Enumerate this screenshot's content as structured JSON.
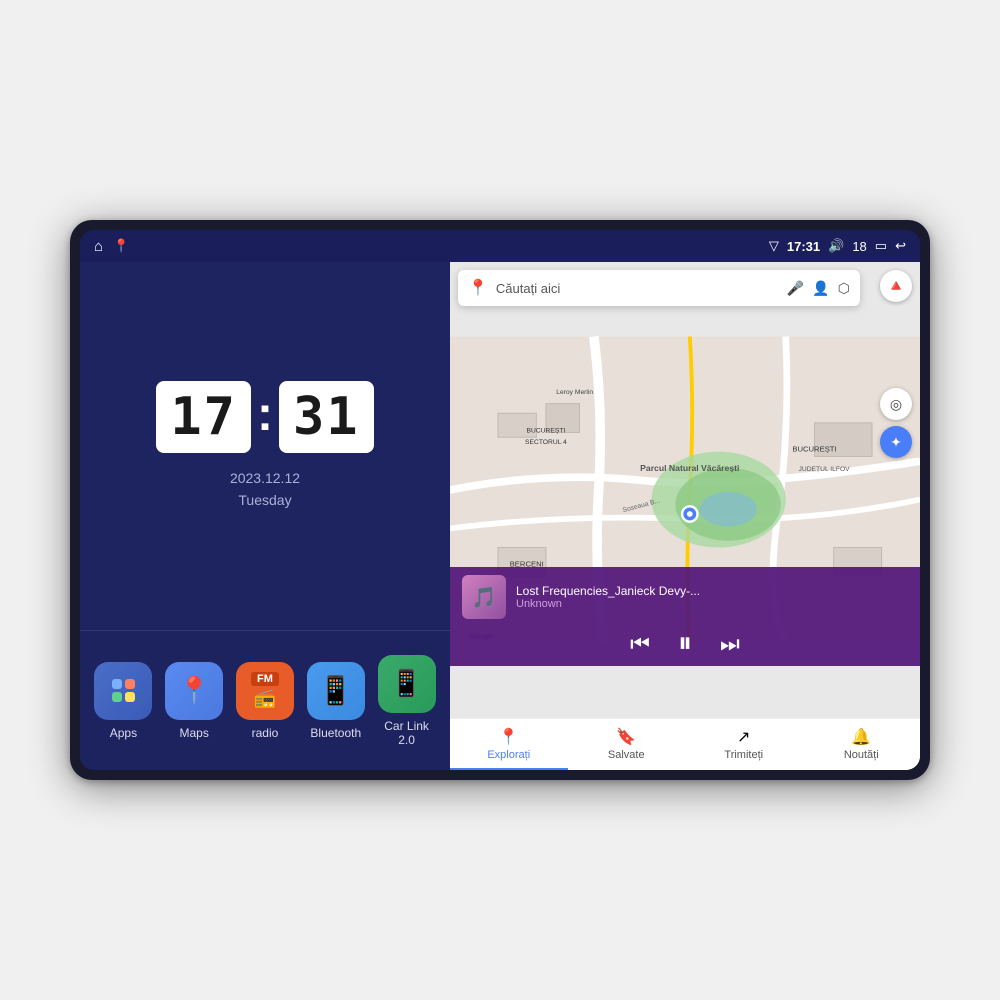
{
  "device": {
    "status_bar": {
      "signal_icon": "▽",
      "time": "17:31",
      "volume_icon": "🔊",
      "volume_level": "18",
      "battery_icon": "🔋",
      "back_icon": "↩"
    },
    "clock": {
      "hours": "17",
      "minutes": "31",
      "date": "2023.12.12",
      "day": "Tuesday"
    },
    "apps": [
      {
        "id": "apps",
        "label": "Apps",
        "icon_type": "apps"
      },
      {
        "id": "maps",
        "label": "Maps",
        "icon_type": "maps"
      },
      {
        "id": "radio",
        "label": "radio",
        "icon_type": "radio"
      },
      {
        "id": "bluetooth",
        "label": "Bluetooth",
        "icon_type": "bt"
      },
      {
        "id": "carlink",
        "label": "Car Link 2.0",
        "icon_type": "carlink"
      }
    ],
    "map": {
      "search_placeholder": "Căutați aici",
      "location_name": "Parcul Natural Văcărești",
      "nav_items": [
        {
          "id": "explore",
          "label": "Explorați",
          "icon": "📍",
          "active": true
        },
        {
          "id": "saved",
          "label": "Salvate",
          "icon": "🔖",
          "active": false
        },
        {
          "id": "share",
          "label": "Trimiteți",
          "icon": "↗",
          "active": false
        },
        {
          "id": "news",
          "label": "Noutăți",
          "icon": "🔔",
          "active": false
        }
      ]
    },
    "music": {
      "title": "Lost Frequencies_Janieck Devy-...",
      "artist": "Unknown",
      "prev_icon": "⏮",
      "play_icon": "⏸",
      "next_icon": "⏭"
    }
  }
}
